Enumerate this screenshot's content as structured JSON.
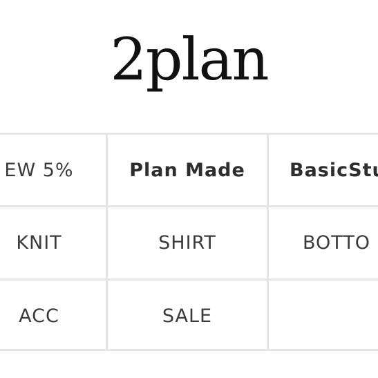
{
  "brand": {
    "logo_text": "2plan"
  },
  "menu": {
    "rows": [
      [
        "EW 5%",
        "Plan Made",
        "BasicStu"
      ],
      [
        "KNIT",
        "SHIRT",
        "BOTTO"
      ],
      [
        "ACC",
        "SALE",
        ""
      ]
    ]
  },
  "colors": {
    "text": "#3a3a3a",
    "divider": "#e6e6e6",
    "background": "#ffffff"
  }
}
